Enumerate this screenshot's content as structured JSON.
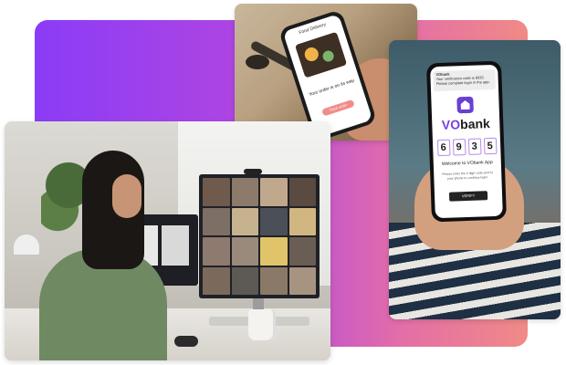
{
  "colors": {
    "gradient_start": "#8b3cf7",
    "gradient_end": "#f08a86",
    "bank_brand": "#6b3fd3"
  },
  "food_app": {
    "header": "Food Delivery",
    "message": "Your order is on its way",
    "button_label": "Track order"
  },
  "bank_app": {
    "notification_title": "VObank",
    "notification_text": "Your verification code is 6935. Please complete login in the app.",
    "brand_prefix": "VO",
    "brand_suffix": "bank",
    "code_digits": [
      "6",
      "9",
      "3",
      "5"
    ],
    "welcome": "Welcome to VObank App",
    "info": "Please enter the 4 digit code sent to your phone to continue login.",
    "verify_label": "VERIFY"
  },
  "video_call": {
    "tiles": [
      "#6f5a4d",
      "#8c7a6a",
      "#c0a88c",
      "#5a4a3f",
      "#7d6f65",
      "#c7b28f",
      "#4b4f57",
      "#d1b682",
      "#8f7a70",
      "#9a8a7c",
      "#e1c46a",
      "#6a5d54",
      "#7b6a5c",
      "#5d5a55",
      "#8b7968",
      "#a69380"
    ]
  }
}
